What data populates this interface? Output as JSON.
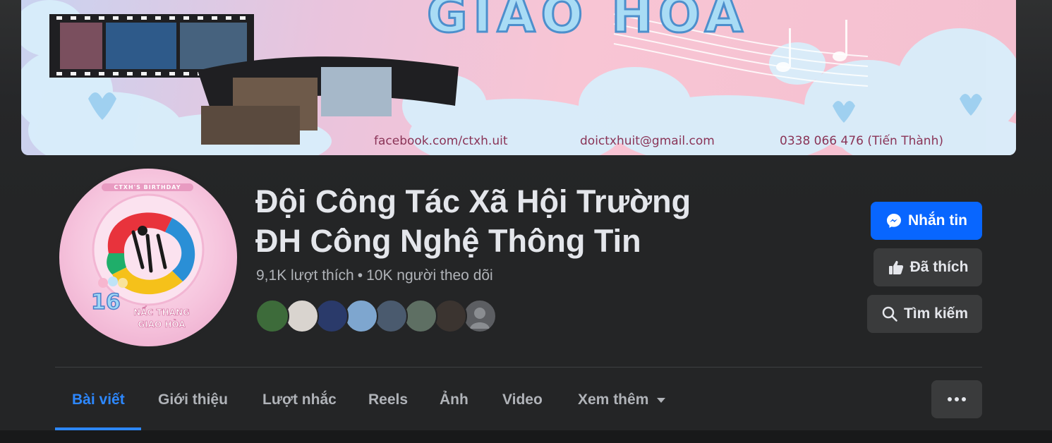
{
  "cover": {
    "title": "GIAO HÒA",
    "facebook": "facebook.com/ctxh.uit",
    "email": "doictxhuit@gmail.com",
    "phone": "0338 066 476 (Tiến Thành)"
  },
  "avatar": {
    "caption": "CTXH'S BIRTHDAY",
    "number": "16",
    "subtitle_line1": "NẤC THANG",
    "subtitle_line2": "GIAO HÒA"
  },
  "page": {
    "name_line1": "Đội Công Tác Xã Hội Trường",
    "name_line2": "ĐH Công Nghệ Thông Tin",
    "likes": "9,1K lượt thích",
    "separator": "•",
    "followers": "10K người theo dõi"
  },
  "friends": [
    {
      "color": "#3d6b3a"
    },
    {
      "color": "#d9d4cf"
    },
    {
      "color": "#2a3a6a"
    },
    {
      "color": "#7ea6cf"
    },
    {
      "color": "#4a5a6e"
    },
    {
      "color": "#5e6f63"
    },
    {
      "color": "#3b3430"
    },
    {
      "color": "#5c5e62"
    }
  ],
  "actions": {
    "message": "Nhắn tin",
    "liked": "Đã thích",
    "search": "Tìm kiếm"
  },
  "tabs": {
    "posts": "Bài viết",
    "about": "Giới thiệu",
    "mentions": "Lượt nhắc",
    "reels": "Reels",
    "photos": "Ảnh",
    "videos": "Video",
    "more": "Xem thêm"
  },
  "colors": {
    "accent": "#0866ff",
    "active_tab": "#2d88ff",
    "background": "#242526"
  }
}
